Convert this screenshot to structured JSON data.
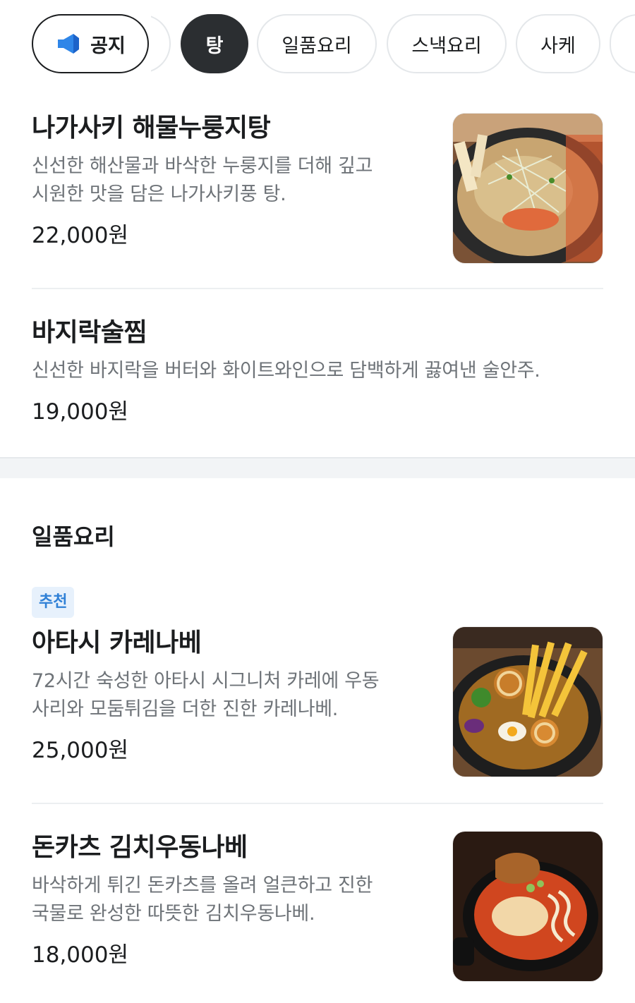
{
  "tabs": [
    {
      "label": "공지",
      "icon": "speaker-icon"
    },
    {
      "label": "탕",
      "active": true
    },
    {
      "label": "일품요리"
    },
    {
      "label": "스낵요리"
    },
    {
      "label": "사케"
    }
  ],
  "menu_items": [
    {
      "title": "나가사키 해물누룽지탕",
      "desc_line1": "신선한 해산물과 바삭한 누룽지를 더해 깊고",
      "desc_line2": "시원한 맛을 담은 나가사키풍 탕.",
      "price": "22,000원"
    },
    {
      "title": "바지락술찜",
      "desc_line1": "신선한 바지락을 버터와 화이트와인으로 담백하게 끓여낸 술안주.",
      "price": "19,000원"
    },
    {
      "badge": "추천",
      "title": "아타시 카레나베",
      "desc_line1": "72시간 숙성한 아타시 시그니처 카레에 우동",
      "desc_line2": "사리와 모둠튀김을 더한 진한 카레나베.",
      "price": "25,000원"
    },
    {
      "title": "돈카츠 김치우동나베",
      "desc_line1": "바삭하게 튀긴 돈카츠를 올려 얼큰하고 진한",
      "desc_line2": "국물로 완성한 따뜻한 김치우동나베.",
      "price": "18,000원"
    }
  ],
  "section": {
    "title": "일품요리"
  },
  "colors": {
    "accent_blue": "#2f80d6",
    "active_chip": "#2b2e31",
    "desc_gray": "#6e7378"
  }
}
